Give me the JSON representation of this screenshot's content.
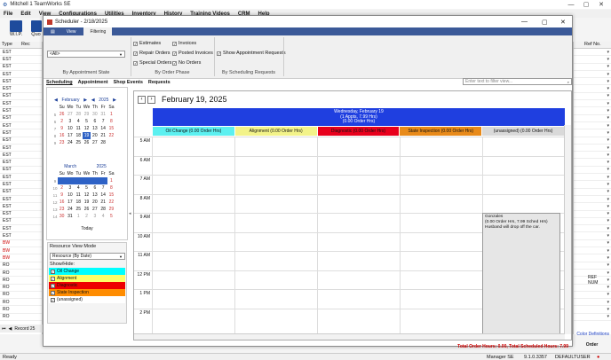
{
  "app": {
    "title": "Mitchell 1 TeamWorks SE"
  },
  "menu": [
    "File",
    "Edit",
    "View",
    "Configurations",
    "Utilities",
    "Inventory",
    "History",
    "Training Videos",
    "CRM",
    "Help"
  ],
  "toolbar": {
    "wip": "W.I.P.",
    "quote": "Quo"
  },
  "left_grid": {
    "col_type": "Type",
    "col_rec": "Rec",
    "rows": [
      "EST",
      "EST",
      "EST",
      "EST",
      "EST",
      "EST",
      "EST",
      "EST",
      "EST",
      "EST",
      "EST",
      "EST",
      "EST",
      "EST",
      "EST",
      "EST",
      "EST",
      "EST",
      "EST",
      "EST",
      "EST",
      "EST",
      "EST",
      "EST",
      "EST",
      "EST",
      "BW",
      "BW",
      "BW",
      "RO",
      "RO",
      "RO",
      "RO",
      "RO",
      "RO",
      "RO",
      "RO"
    ],
    "record": "Record 25"
  },
  "right_grid": {
    "col": "Ref No.",
    "ref_num": "REF NUM",
    "color_defs": "Color Definitions",
    "order": "Order"
  },
  "status": {
    "ready": "Ready",
    "user_level": "Manager SE",
    "version": "9.1.0.3357",
    "user": "DEFAULTUSER"
  },
  "dialog": {
    "title": "Scheduler - 2/18/2025",
    "tabs": [
      "View",
      "Filtering"
    ],
    "filter": {
      "all": "<All>",
      "by_status": "By Appointment State",
      "by_phase": "By Order Phase",
      "by_requests": "By Scheduling Requests",
      "checks": [
        {
          "label": "Estimates",
          "on": true
        },
        {
          "label": "Repair Orders",
          "on": true
        },
        {
          "label": "Special Orders",
          "on": true
        },
        {
          "label": "Invoices",
          "on": true
        },
        {
          "label": "Posted Invoices",
          "on": true
        },
        {
          "label": "No Orders",
          "on": true
        }
      ],
      "show_requests": "Show Appointment Requests",
      "search_placeholder": "Enter text to filter view..."
    },
    "nav": [
      "Scheduling",
      "Appointment",
      "Shop Events",
      "Requests"
    ],
    "cal1": {
      "month": "February",
      "year": "2025",
      "dow": [
        "Su",
        "Mo",
        "Tu",
        "We",
        "Th",
        "Fr",
        "Sa"
      ],
      "weeks": [
        {
          "w": "5",
          "d": [
            "26",
            "27",
            "28",
            "29",
            "30",
            "31",
            "1"
          ]
        },
        {
          "w": "6",
          "d": [
            "2",
            "3",
            "4",
            "5",
            "6",
            "7",
            "8"
          ]
        },
        {
          "w": "7",
          "d": [
            "9",
            "10",
            "11",
            "12",
            "13",
            "14",
            "15"
          ]
        },
        {
          "w": "8",
          "d": [
            "16",
            "17",
            "18",
            "19",
            "20",
            "21",
            "22"
          ]
        },
        {
          "w": "9",
          "d": [
            "23",
            "24",
            "25",
            "26",
            "27",
            "28",
            ""
          ]
        }
      ]
    },
    "cal2": {
      "month": "March",
      "year": "2025",
      "dow": [
        "Su",
        "Mo",
        "Tu",
        "We",
        "Th",
        "Fr",
        "Sa"
      ],
      "weeks": [
        {
          "w": "9",
          "d": [
            "",
            "",
            "",
            "",
            "",
            "",
            "1"
          ]
        },
        {
          "w": "10",
          "d": [
            "2",
            "3",
            "4",
            "5",
            "6",
            "7",
            "8"
          ]
        },
        {
          "w": "11",
          "d": [
            "9",
            "10",
            "11",
            "12",
            "13",
            "14",
            "15"
          ]
        },
        {
          "w": "12",
          "d": [
            "16",
            "17",
            "18",
            "19",
            "20",
            "21",
            "22"
          ]
        },
        {
          "w": "13",
          "d": [
            "23",
            "24",
            "25",
            "26",
            "27",
            "28",
            "29"
          ]
        },
        {
          "w": "14",
          "d": [
            "30",
            "31",
            "1",
            "2",
            "3",
            "4",
            "5"
          ]
        }
      ]
    },
    "today": "Today",
    "resource_mode": {
      "label": "Resource View Mode",
      "value": "Resource (By Date)",
      "show_hide": "Show/Hide:",
      "items": [
        {
          "label": "Oil Change",
          "color": "#00ffff"
        },
        {
          "label": "Alignment",
          "color": "#ffff66"
        },
        {
          "label": "Diagnostic",
          "color": "#ee0000"
        },
        {
          "label": "State Inspection",
          "color": "#ff8c00"
        },
        {
          "label": "(unassigned)",
          "color": "#ffffff"
        }
      ]
    },
    "schedule": {
      "date_title": "February 19, 2025",
      "banner": [
        "Wednesday, February 19",
        "(1 Appts, 7.99 Hrs)",
        "(0.00 Order Hrs)"
      ],
      "columns": [
        {
          "label": "Oil Change  (0.00 Order Hrs)",
          "color": "#5cf0f0"
        },
        {
          "label": "Alignment  (0.00 Order Hrs)",
          "color": "#f3f389"
        },
        {
          "label": "Diagnostic  (0.00 Order Hrs)",
          "color": "#e8001c"
        },
        {
          "label": "State Inspection  (0.00 Order Hrs)",
          "color": "#e88a1a"
        },
        {
          "label": "(unassigned)  (0.00 Order Hrs)",
          "color": "#d9d9d9"
        }
      ],
      "hours": [
        "5 AM",
        "6 AM",
        "7 AM",
        "8 AM",
        "9 AM",
        "10 AM",
        "11 AM",
        "12 PM",
        "1 PM",
        "2 PM"
      ],
      "appointment": [
        "Gonzales",
        "(0.00 Order Hrs, 7.99 Sched Hrs)",
        "Husband will drop off the car."
      ]
    },
    "totals": "Total Order Hours: 0.00, Total Scheduled Hours: 7.99"
  }
}
